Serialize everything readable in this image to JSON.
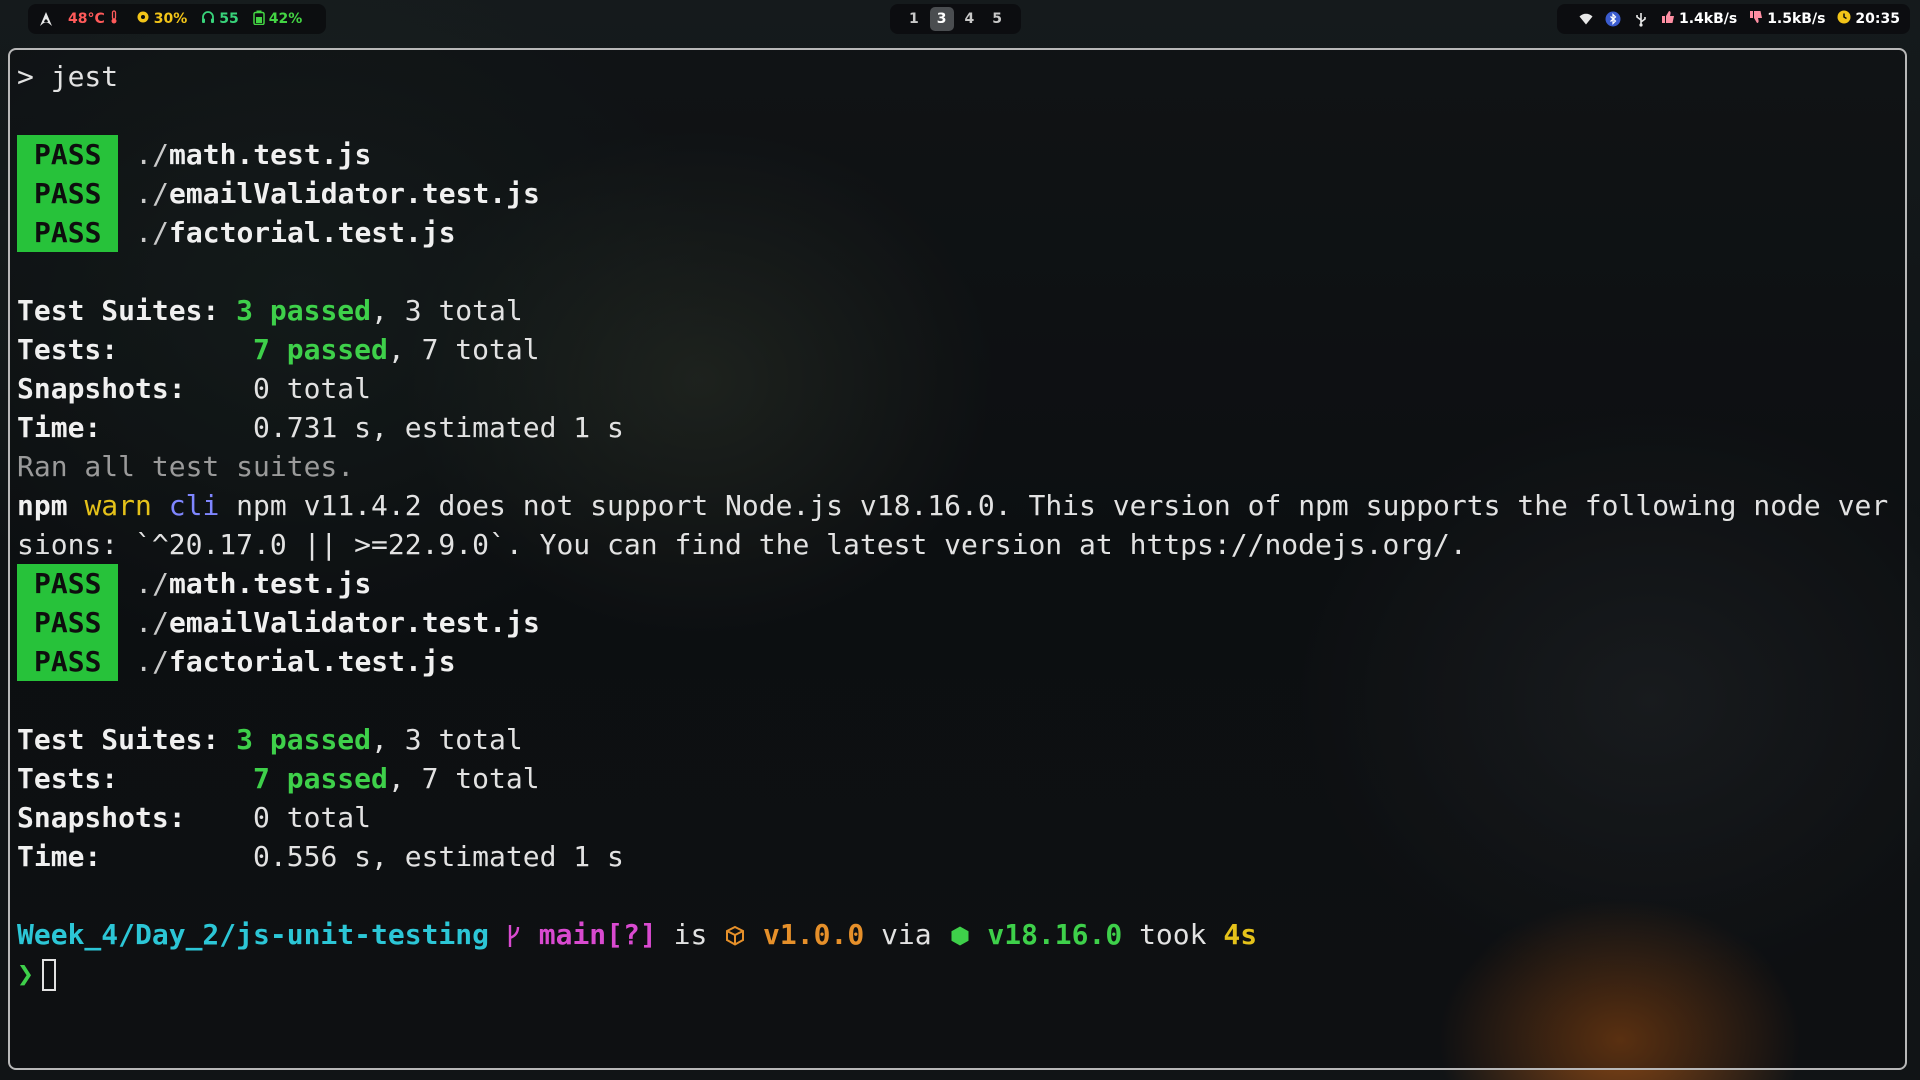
{
  "topbar": {
    "left": {
      "arch_icon": "arch-linux-icon",
      "temp": "48°C",
      "temp_icon": "thermometer-icon",
      "cpu_icon": "cpu-icon",
      "cpu": "30%",
      "headphone_icon": "headphones-icon",
      "volume": "55",
      "battery_icon": "battery-icon",
      "battery": "42%"
    },
    "workspaces": [
      "1",
      "3",
      "4",
      "5"
    ],
    "active_workspace": "3",
    "right": {
      "wifi_icon": "wifi-icon",
      "bluetooth_icon": "bluetooth-icon",
      "usb_icon": "usb-icon",
      "up_speed": "1.4kB/s",
      "down_speed": "1.5kB/s",
      "time": "20:35"
    },
    "colors": {
      "temp": "#ff5a5a",
      "cpu": "#f2c418",
      "volume": "#38d37a",
      "battery": "#43d443",
      "net": "#ff8fa3",
      "clock": "#f2c418"
    }
  },
  "terminal": {
    "command_prompt": "> jest",
    "run1": {
      "tests": [
        {
          "status": "PASS",
          "dir": "./",
          "file": "math.test.js"
        },
        {
          "status": "PASS",
          "dir": "./",
          "file": "emailValidator.test.js"
        },
        {
          "status": "PASS",
          "dir": "./",
          "file": "factorial.test.js"
        }
      ],
      "suites_label": "Test Suites:",
      "suites_passed": "3 passed",
      "suites_total": ", 3 total",
      "tests_label": "Tests:",
      "tests_passed": "7 passed",
      "tests_total": ", 7 total",
      "snapshots_label": "Snapshots:",
      "snapshots_value": "0 total",
      "time_label": "Time:",
      "time_value": "0.731 s, estimated 1 s"
    },
    "ran_all": "Ran all test suites.",
    "npm_warn": {
      "npm": "npm",
      "warn": "warn",
      "cli": "cli",
      "line1": "npm v11.4.2 does not support Node.js v18.16.0. This version of npm supports the following node ver",
      "line2": "sions: `^20.17.0 || >=22.9.0`. You can find the latest version at https://nodejs.org/."
    },
    "run2": {
      "tests": [
        {
          "status": "PASS",
          "dir": "./",
          "file": "math.test.js"
        },
        {
          "status": "PASS",
          "dir": "./",
          "file": "emailValidator.test.js"
        },
        {
          "status": "PASS",
          "dir": "./",
          "file": "factorial.test.js"
        }
      ],
      "suites_label": "Test Suites:",
      "suites_passed": "3 passed",
      "suites_total": ", 3 total",
      "tests_label": "Tests:",
      "tests_passed": "7 passed",
      "tests_total": ", 7 total",
      "snapshots_label": "Snapshots:",
      "snapshots_value": "0 total",
      "time_label": "Time:",
      "time_value": "0.556 s, estimated 1 s"
    },
    "prompt": {
      "path": "Week_4/Day_2/js-unit-testing",
      "branch_icon": "git-branch-icon",
      "branch": "main[?]",
      "is": "is",
      "package_icon": "package-icon",
      "version": "v1.0.0",
      "via": "via",
      "node_icon": "nodejs-icon",
      "node_version": "v18.16.0",
      "took": "took",
      "duration": "4s",
      "symbol": "❯"
    }
  }
}
